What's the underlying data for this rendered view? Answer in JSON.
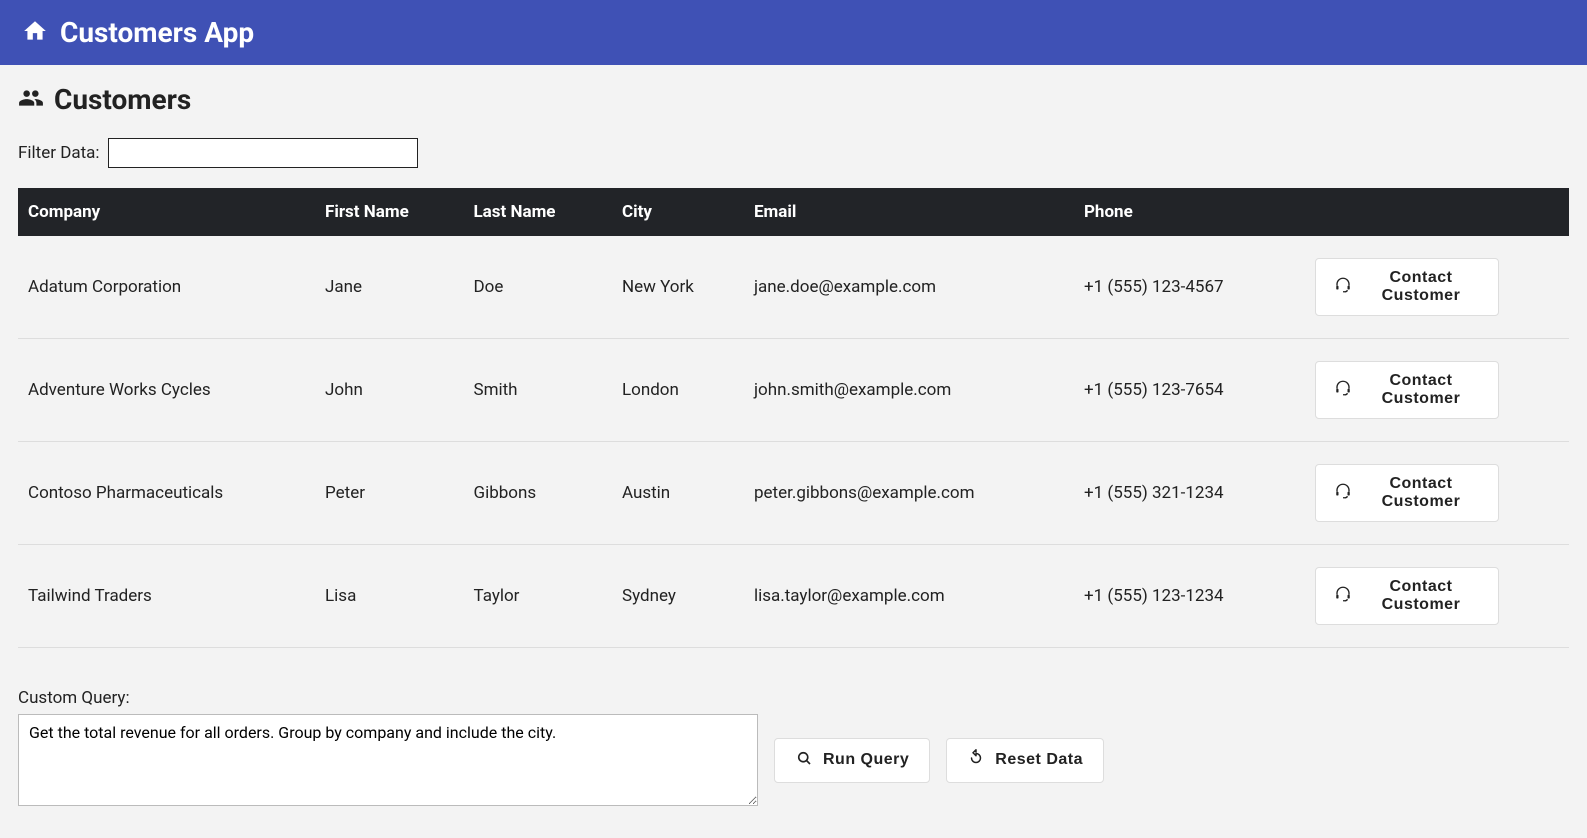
{
  "header": {
    "title": "Customers App"
  },
  "page": {
    "heading": "Customers"
  },
  "filter": {
    "label": "Filter Data:",
    "value": ""
  },
  "table": {
    "columns": [
      "Company",
      "First Name",
      "Last Name",
      "City",
      "Email",
      "Phone"
    ],
    "contactLabel": "Contact Customer",
    "rows": [
      {
        "company": "Adatum Corporation",
        "firstName": "Jane",
        "lastName": "Doe",
        "city": "New York",
        "email": "jane.doe@example.com",
        "phone": "+1 (555) 123-4567"
      },
      {
        "company": "Adventure Works Cycles",
        "firstName": "John",
        "lastName": "Smith",
        "city": "London",
        "email": "john.smith@example.com",
        "phone": "+1 (555) 123-7654"
      },
      {
        "company": "Contoso Pharmaceuticals",
        "firstName": "Peter",
        "lastName": "Gibbons",
        "city": "Austin",
        "email": "peter.gibbons@example.com",
        "phone": "+1 (555) 321-1234"
      },
      {
        "company": "Tailwind Traders",
        "firstName": "Lisa",
        "lastName": "Taylor",
        "city": "Sydney",
        "email": "lisa.taylor@example.com",
        "phone": "+1 (555) 123-1234"
      }
    ]
  },
  "query": {
    "label": "Custom Query:",
    "value": "Get the total revenue for all orders. Group by company and include the city.",
    "runLabel": "Run Query",
    "resetLabel": "Reset Data"
  }
}
